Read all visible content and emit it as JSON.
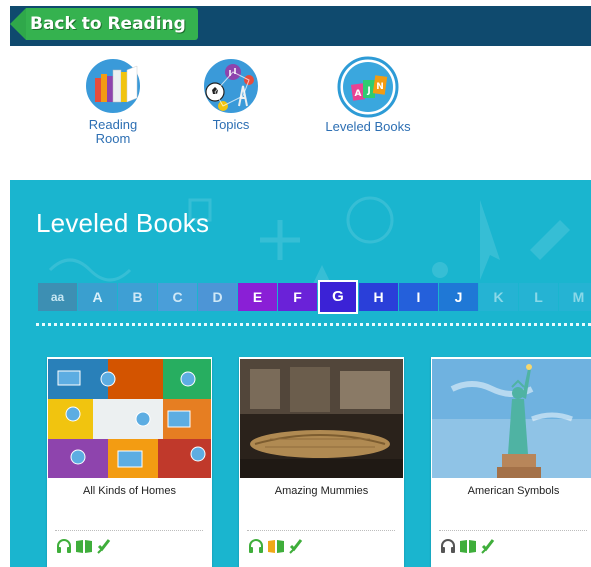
{
  "topbar": {
    "back_label": "Back to Reading"
  },
  "nav": {
    "items": [
      {
        "label_line1": "Reading",
        "label_line2": "Room",
        "icon": "books-icon"
      },
      {
        "label_line1": "Topics",
        "label_line2": "",
        "icon": "topics-icon"
      },
      {
        "label_line1": "Leveled Books",
        "label_line2": "",
        "icon": "leveled-books-icon"
      }
    ]
  },
  "leveled": {
    "title": "Leveled Books",
    "levels": [
      "aa",
      "A",
      "B",
      "C",
      "D",
      "E",
      "F",
      "G",
      "H",
      "I",
      "J",
      "K",
      "L",
      "M"
    ],
    "selected_level": "G"
  },
  "books": [
    {
      "title": "All Kinds of Homes",
      "resources": [
        "headphones-icon",
        "book-icon",
        "quiz-icon"
      ]
    },
    {
      "title": "Amazing Mummies",
      "resources": [
        "headphones-icon",
        "book-icon",
        "quiz-icon"
      ]
    },
    {
      "title": "American Symbols",
      "resources": [
        "headphones-icon",
        "book-icon",
        "quiz-icon"
      ]
    }
  ],
  "colors": {
    "topbar": "#0f4a6e",
    "back_button": "#35b24f",
    "section_bg": "#1ab5cf",
    "nav_label": "#2d6fb3",
    "selected_level": "#3b22d6",
    "resource_icon": "#3fae3b"
  }
}
